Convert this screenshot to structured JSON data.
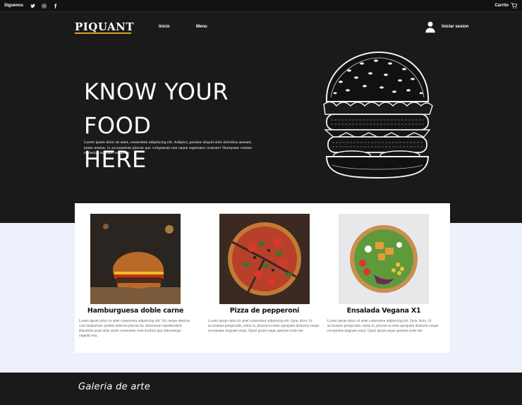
{
  "topbar": {
    "follow_label": "Siguenos",
    "social_icons": [
      "twitter-icon",
      "instagram-icon",
      "facebook-icon"
    ],
    "cart_label": "Carrito"
  },
  "nav": {
    "logo": "PIQUANT",
    "links": [
      "Inicio",
      "Menu"
    ],
    "login_label": "Iniciar sesion"
  },
  "hero": {
    "title_line1": "KNOW YOUR FOOD",
    "title_line2": "HERE",
    "text": "Lorem ipsum dolor sit amet, consectetur adipisicing elit. Adipisci, pariatur aliquid nihil doloribus aeneant, totam tenetur, in accusantium placeat quo voluptatum non eaque aspernatur nostrum! Numquam veniam molestias magnam voluptate."
  },
  "cards": [
    {
      "title": "Hamburguesa doble carne",
      "desc": "Lorem ipsum dolor sit amet consectetur adipisicing elit. Vel, neque delectus cum laudantium quidem delectus placeat hic laboriosam reprehenderit. Blanditiis quasi alias animi consectetur eum mollitia ipsa doloremque impedit eius."
    },
    {
      "title": "Pizza de pepperoni",
      "desc": "Lorem ipsum dolor sit amet consectetur adipisicing elit. Quia, dicta. Ut accusamus perspiciatis, nemo in, placeat ea enim quisquam distinctio neque recusandae magnam sequi. Quasi ipsum eaque aperiam unde iste."
    },
    {
      "title": "Ensalada Vegana X1",
      "desc": "Lorem ipsum dolor sit amet consectetur adipisicing elit. Quia, dicta. Ut accusamus perspiciatis, nemo in, placeat ea enim quisquam distinctio neque recusandae magnam sequi. Quasi ipsum eaque aperiam unde iste."
    }
  ],
  "gallery": {
    "title": "Galeria de arte"
  },
  "colors": {
    "background_dark": "#1b1a1a",
    "accent_gold": "#d8a32a",
    "light_band": "#ecf1fb"
  }
}
